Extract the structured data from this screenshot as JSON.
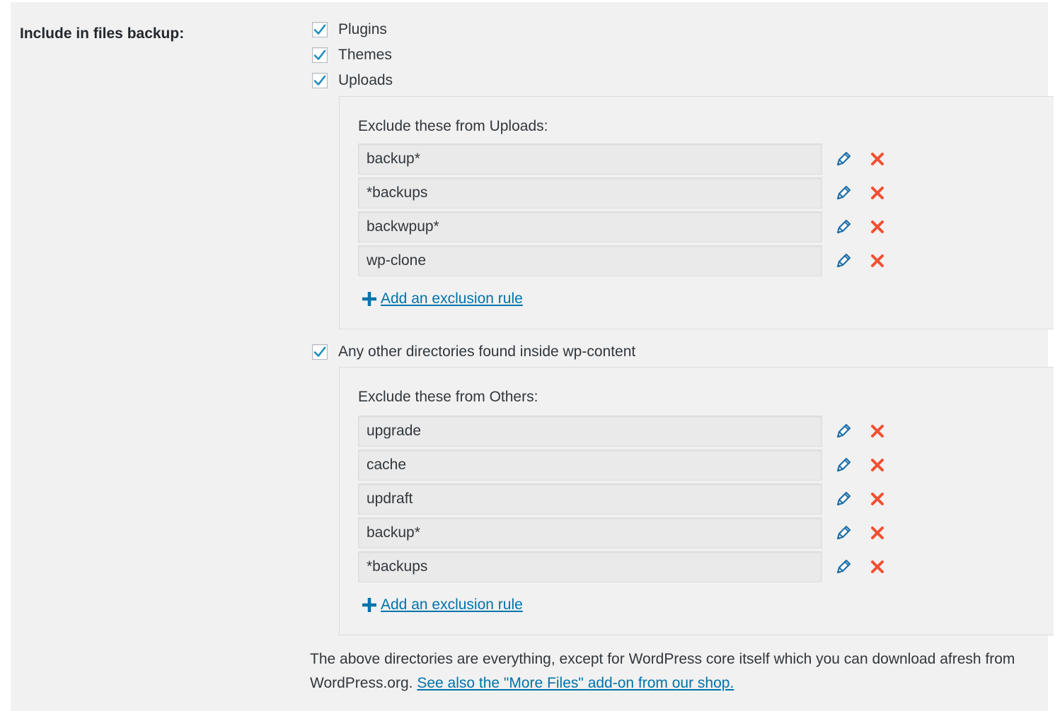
{
  "section_label": "Include in files backup:",
  "checkboxes": [
    {
      "label": "Plugins",
      "checked": true
    },
    {
      "label": "Themes",
      "checked": true
    },
    {
      "label": "Uploads",
      "checked": true
    },
    {
      "label": "Any other directories found inside wp-content",
      "checked": true
    }
  ],
  "uploads_exclusions": {
    "title": "Exclude these from Uploads:",
    "rules": [
      "backup*",
      "*backups",
      "backwpup*",
      "wp-clone"
    ],
    "add_label": "Add an exclusion rule"
  },
  "others_exclusions": {
    "title": "Exclude these from Others:",
    "rules": [
      "upgrade",
      "cache",
      "updraft",
      "backup*",
      "*backups"
    ],
    "add_label": "Add an exclusion rule"
  },
  "footer": {
    "text": "The above directories are everything, except for WordPress core itself which you can download afresh from WordPress.org.",
    "link": "See also the \"More Files\" add-on from our shop."
  },
  "colors": {
    "accent": "#0073aa",
    "check": "#1e8cbe",
    "delete": "#f05032",
    "panel_bg": "#f1f1f1"
  }
}
